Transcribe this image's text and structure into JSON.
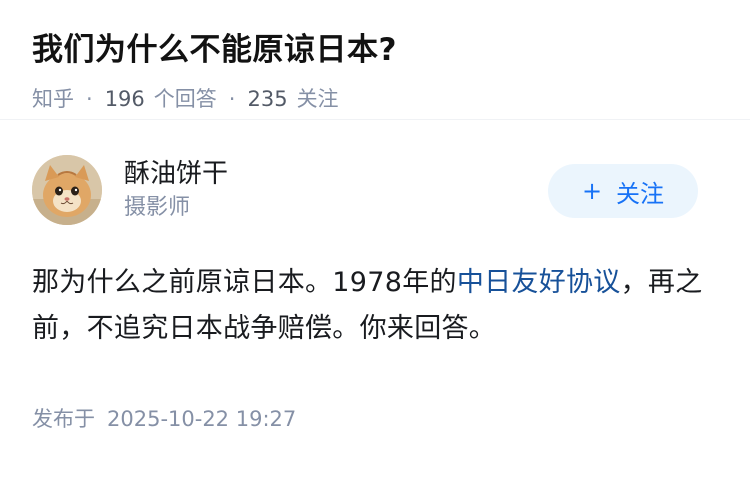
{
  "question": {
    "title": "我们为什么不能原谅日本?",
    "source": "知乎",
    "answer_count": "196",
    "answer_label": "个回答",
    "follow_count": "235",
    "follow_label": "关注",
    "separator": "·"
  },
  "answer": {
    "author_name": "酥油饼干",
    "author_bio": "摄影师",
    "follow_button_label": "关注",
    "follow_button_icon": "+",
    "content_part1": "那为什么之前原谅日本。1978年的",
    "content_link": "中日友好协议",
    "content_part2": "，再之前，不追究日本战争赔偿。你来回答。",
    "published_label": "发布于",
    "published_time": "2025-10-22 19:27"
  },
  "colors": {
    "link": "#175199",
    "meta": "#8590a6",
    "follow_bg": "#ebf5fd",
    "follow_text": "#1772f6"
  },
  "icons": {
    "avatar": "cat-avatar-image"
  }
}
